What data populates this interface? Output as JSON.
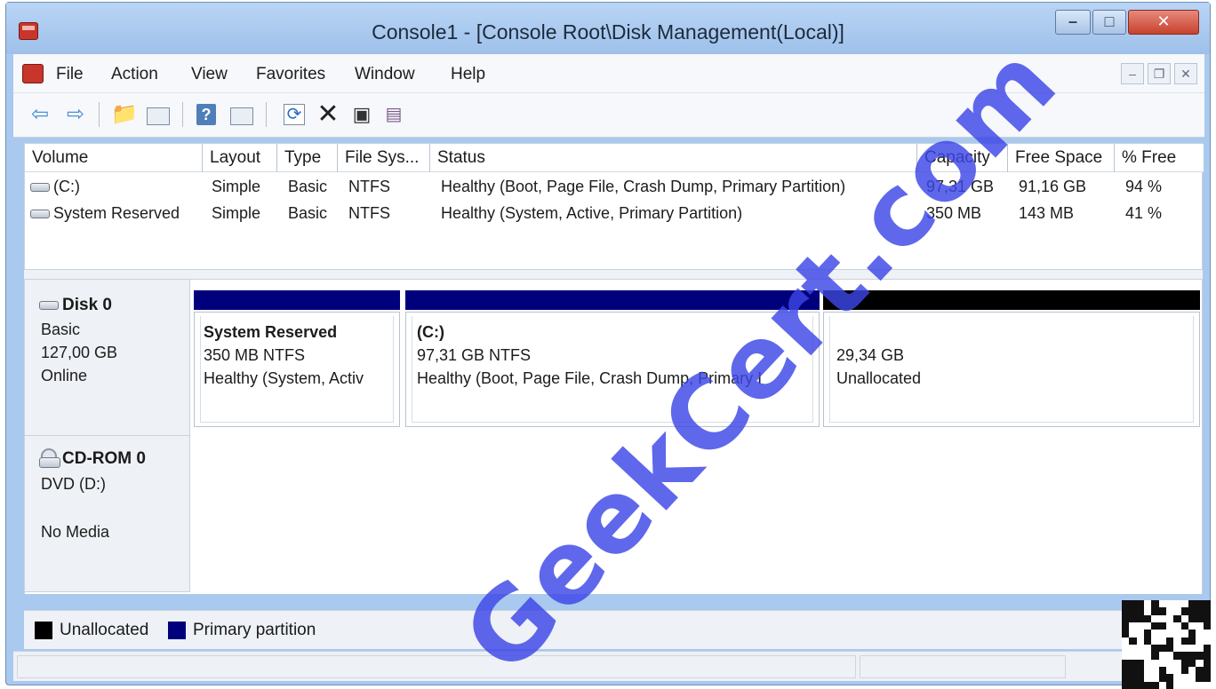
{
  "window": {
    "title": "Console1 - [Console Root\\Disk Management(Local)]"
  },
  "menu": {
    "items": [
      "File",
      "Action",
      "View",
      "Favorites",
      "Window",
      "Help"
    ]
  },
  "toolbar": {
    "icons": [
      "back-icon",
      "forward-icon",
      "up-folder-icon",
      "show-hide-tree-icon",
      "help-icon",
      "action-pane-icon",
      "refresh-icon",
      "delete-icon",
      "properties-icon",
      "select-icon"
    ]
  },
  "volume_list": {
    "columns": [
      "Volume",
      "Layout",
      "Type",
      "File Sys...",
      "Status",
      "Capacity",
      "Free Space",
      "% Free"
    ],
    "rows": [
      {
        "volume": "(C:)",
        "layout": "Simple",
        "type": "Basic",
        "fs": "NTFS",
        "status": "Healthy (Boot, Page File, Crash Dump, Primary Partition)",
        "capacity": "97,31 GB",
        "free": "91,16 GB",
        "pct": "94 %"
      },
      {
        "volume": "System Reserved",
        "layout": "Simple",
        "type": "Basic",
        "fs": "NTFS",
        "status": "Healthy (System, Active, Primary Partition)",
        "capacity": "350 MB",
        "free": "143 MB",
        "pct": "41 %"
      }
    ]
  },
  "disks": [
    {
      "name": "Disk 0",
      "type": "Basic",
      "size": "127,00 GB",
      "state": "Online",
      "partitions": [
        {
          "title": "System Reserved",
          "line1": "350 MB NTFS",
          "line2": "Healthy (System, Activ",
          "kind": "primary"
        },
        {
          "title": "(C:)",
          "line1": "97,31 GB NTFS",
          "line2": "Healthy (Boot, Page File, Crash Dump, Primary I",
          "kind": "primary"
        },
        {
          "title": "",
          "line1": "29,34 GB",
          "line2": "Unallocated",
          "kind": "unallocated"
        }
      ]
    },
    {
      "name": "CD-ROM 0",
      "type": "DVD (D:)",
      "state": "No Media"
    }
  ],
  "legend": {
    "unallocated": "Unallocated",
    "primary": "Primary partition"
  },
  "colors": {
    "primary": "#00007d",
    "unallocated": "#000000",
    "watermark": "#3c46e6"
  },
  "watermark": "GeekCert.com"
}
